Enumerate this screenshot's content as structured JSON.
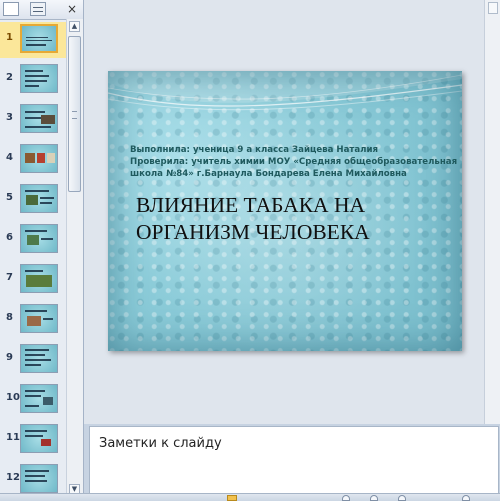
{
  "left_panel": {
    "close_glyph": "×",
    "slides": [
      {
        "number": "1",
        "selected": true
      },
      {
        "number": "2"
      },
      {
        "number": "3"
      },
      {
        "number": "4"
      },
      {
        "number": "5"
      },
      {
        "number": "6"
      },
      {
        "number": "7"
      },
      {
        "number": "8"
      },
      {
        "number": "9"
      },
      {
        "number": "10"
      },
      {
        "number": "11"
      },
      {
        "number": "12"
      }
    ]
  },
  "slide": {
    "credits": [
      "Выполнила:  ученица 9 а класса Зайцева Наталия",
      "Проверила:  учитель химии МОУ «Средняя  общеобразовательная",
      "школа №84»  г.Барнаула Бондарева  Елена  Михайловна"
    ],
    "title_lines": [
      "ВЛИЯНИЕ ТАБАКА НА",
      "ОРГАНИЗМ ЧЕЛОВЕКА"
    ]
  },
  "notes": {
    "placeholder": "Заметки к слайду"
  },
  "colors": {
    "selected_thumb": "#fbe79a",
    "slide_background": "#8cccd9",
    "slide_credits_text": "#1f5a5e"
  }
}
